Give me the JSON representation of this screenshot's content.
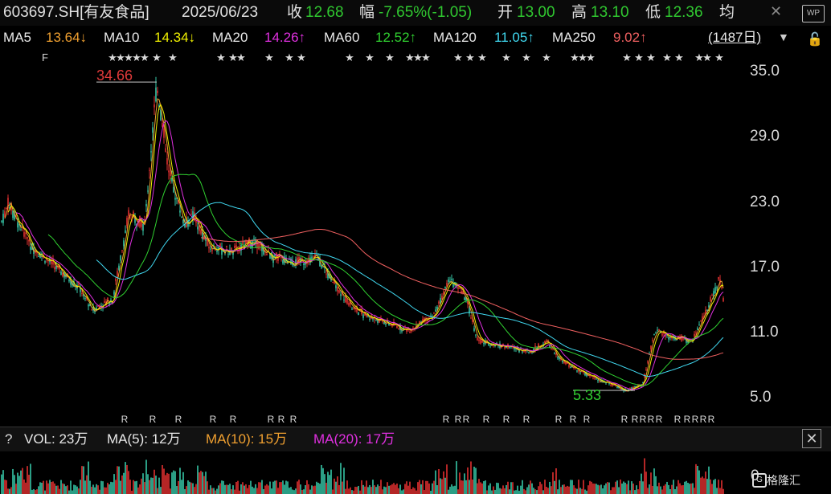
{
  "header": {
    "symbol": "603697.SH[有友食品]",
    "date": "2025/06/23",
    "close_label": "收",
    "close_value": "12.68",
    "change_label": "幅",
    "change_value": "-7.65%(-1.05)",
    "open_label": "开",
    "open_value": "13.00",
    "high_label": "高",
    "high_value": "13.10",
    "low_label": "低",
    "low_value": "12.36",
    "avg_label": "均",
    "close_icon": "x-icon",
    "wp_label": "WP"
  },
  "ma": {
    "ma5_label": "MA5",
    "ma5_value": "13.64↓",
    "ma10_label": "MA10",
    "ma10_value": "14.34↓",
    "ma20_label": "MA20",
    "ma20_value": "14.26↑",
    "ma60_label": "MA60",
    "ma60_value": "12.52↑",
    "ma120_label": "MA120",
    "ma120_value": "11.05↑",
    "ma250_label": "MA250",
    "ma250_value": "9.02↑",
    "period": "(1487日)",
    "dropdown_icon": "triangle-down-icon",
    "lock_icon": "lock-icon"
  },
  "colors": {
    "up": "#e0302f",
    "down": "#36c6a6",
    "ma5": "#f0a030",
    "ma10": "#f0f000",
    "ma20": "#e030e0",
    "ma60": "#30d030",
    "ma120": "#40d8f0",
    "ma250": "#f06060",
    "positive_text": "#30c830",
    "negative_text": "#30c830"
  },
  "volume": {
    "help": "?",
    "vol_label": "VOL: 23万",
    "ma5_label": "MA(5): 12万",
    "ma10_label": "MA(10): 15万",
    "ma20_label": "MA(20): 17万",
    "axis_zero": "0",
    "brand": "格隆汇",
    "close_icon": "close-icon"
  },
  "chart_data": {
    "type": "candlestick",
    "y_ticks": [
      "35.0",
      "29.0",
      "23.0",
      "17.0",
      "11.0",
      "5.0"
    ],
    "ylim": [
      3.5,
      36.5
    ],
    "annotations": [
      {
        "label": "34.66",
        "value": 34.66
      },
      {
        "label": "5.33",
        "value": 5.33
      }
    ],
    "markers_top": "★",
    "markers_bottom": "R",
    "series": [
      {
        "name": "MA5",
        "color": "#f0a030"
      },
      {
        "name": "MA10",
        "color": "#f0f000"
      },
      {
        "name": "MA20",
        "color": "#e030e0"
      },
      {
        "name": "MA60",
        "color": "#30d030"
      },
      {
        "name": "MA120",
        "color": "#40d8f0"
      },
      {
        "name": "MA250",
        "color": "#f06060"
      }
    ]
  }
}
